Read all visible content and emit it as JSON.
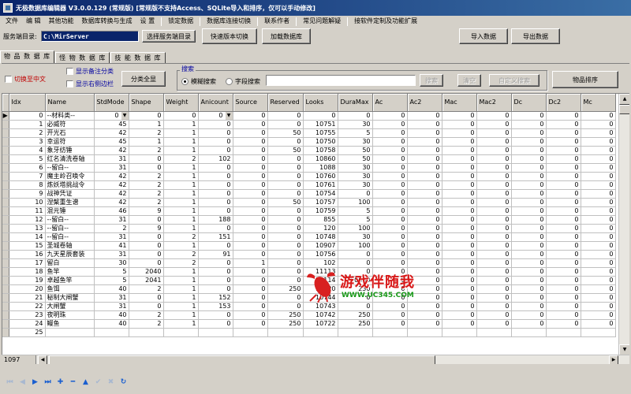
{
  "window": {
    "title": "无极数据库编辑器 V3.0.0.129 (常规版) [常规版不支持Access、SQLite导入和排序，仅可以手动修改]"
  },
  "menu": {
    "items": [
      "文件",
      "编 辑",
      "其他功能",
      "数据库转换与生成",
      "设 置"
    ],
    "items2": [
      "锁定数据",
      "数据库连接切换",
      "联系作者",
      "常见问题解疑",
      "接软件定制及功能扩展"
    ]
  },
  "toolbar": {
    "server_dir_label": "服务端目录:",
    "server_dir_value": "C:\\MirServer",
    "select_dir_button": "选择服务端目录",
    "quick_switch_button": "快速版本切换",
    "load_db_button": "加载数据库",
    "import_button": "导入数据",
    "export_button": "导出数据"
  },
  "tabs": [
    "物 品 数 据 库",
    "怪 物 数 据 库",
    "技 能 数 据 库"
  ],
  "options": {
    "switch_chinese": "切换至中文",
    "show_notes_category": "显示备注分类",
    "show_right_sidebar": "显示右侧边栏",
    "category_all_button": "分类全显",
    "search_group_title": "搜索",
    "fuzzy_search": "模糊搜索",
    "field_search": "字段搜索",
    "search_button": "搜索",
    "clear_button": "清空",
    "custom_search_button": "自定义搜索",
    "item_sort_button": "物品排序"
  },
  "grid": {
    "columns": [
      "Idx",
      "Name",
      "StdMode",
      "Shape",
      "Weight",
      "Anicount",
      "Source",
      "Reserved",
      "Looks",
      "DuraMax",
      "Ac",
      "Ac2",
      "Mac",
      "Mac2",
      "Dc",
      "Dc2",
      "Mc"
    ],
    "rows": [
      [
        "0",
        "--材料类--",
        "0",
        "0",
        "0",
        "0",
        "0",
        "0",
        "0",
        "0",
        "0",
        "0",
        "0",
        "0",
        "0",
        "0",
        "0"
      ],
      [
        "1",
        "必威符",
        "45",
        "1",
        "1",
        "0",
        "0",
        "0",
        "10751",
        "30",
        "0",
        "0",
        "0",
        "0",
        "0",
        "0",
        "0"
      ],
      [
        "2",
        "开光石",
        "42",
        "2",
        "1",
        "0",
        "0",
        "50",
        "10755",
        "5",
        "0",
        "0",
        "0",
        "0",
        "0",
        "0",
        "0"
      ],
      [
        "3",
        "幸运符",
        "45",
        "1",
        "1",
        "0",
        "0",
        "0",
        "10750",
        "30",
        "0",
        "0",
        "0",
        "0",
        "0",
        "0",
        "0"
      ],
      [
        "4",
        "象牙纺锤",
        "42",
        "2",
        "1",
        "0",
        "0",
        "50",
        "10758",
        "50",
        "0",
        "0",
        "0",
        "0",
        "0",
        "0",
        "0"
      ],
      [
        "5",
        "红名清洗卷轴",
        "31",
        "0",
        "2",
        "102",
        "0",
        "0",
        "10860",
        "50",
        "0",
        "0",
        "0",
        "0",
        "0",
        "0",
        "0"
      ],
      [
        "6",
        "--留白--",
        "31",
        "0",
        "1",
        "0",
        "0",
        "0",
        "1088",
        "30",
        "0",
        "0",
        "0",
        "0",
        "0",
        "0",
        "0"
      ],
      [
        "7",
        "魔主岭召唤令",
        "42",
        "2",
        "1",
        "0",
        "0",
        "0",
        "10760",
        "30",
        "0",
        "0",
        "0",
        "0",
        "0",
        "0",
        "0"
      ],
      [
        "8",
        "炼妖塔挑战令",
        "42",
        "2",
        "1",
        "0",
        "0",
        "0",
        "10761",
        "30",
        "0",
        "0",
        "0",
        "0",
        "0",
        "0",
        "0"
      ],
      [
        "9",
        "战神凭证",
        "42",
        "2",
        "1",
        "0",
        "0",
        "0",
        "10754",
        "0",
        "0",
        "0",
        "0",
        "0",
        "0",
        "0",
        "0"
      ],
      [
        "10",
        "涅槃重生谱",
        "42",
        "2",
        "1",
        "0",
        "0",
        "50",
        "10757",
        "100",
        "0",
        "0",
        "0",
        "0",
        "0",
        "0",
        "0"
      ],
      [
        "11",
        "混元锤",
        "46",
        "9",
        "1",
        "0",
        "0",
        "0",
        "10759",
        "5",
        "0",
        "0",
        "0",
        "0",
        "0",
        "0",
        "0"
      ],
      [
        "12",
        "--留白--",
        "31",
        "0",
        "1",
        "188",
        "0",
        "0",
        "855",
        "5",
        "0",
        "0",
        "0",
        "0",
        "0",
        "0",
        "0"
      ],
      [
        "13",
        "--留白--",
        "2",
        "9",
        "1",
        "0",
        "0",
        "0",
        "120",
        "100",
        "0",
        "0",
        "0",
        "0",
        "0",
        "0",
        "0"
      ],
      [
        "14",
        "--留白--",
        "31",
        "0",
        "2",
        "151",
        "0",
        "0",
        "10748",
        "30",
        "0",
        "0",
        "0",
        "0",
        "0",
        "0",
        "0"
      ],
      [
        "15",
        "圣城卷轴",
        "41",
        "0",
        "1",
        "0",
        "0",
        "0",
        "10907",
        "100",
        "0",
        "0",
        "0",
        "0",
        "0",
        "0",
        "0"
      ],
      [
        "16",
        "九天星辰套装",
        "31",
        "0",
        "2",
        "91",
        "0",
        "0",
        "10756",
        "0",
        "0",
        "0",
        "0",
        "0",
        "0",
        "0",
        "0"
      ],
      [
        "17",
        "留白",
        "30",
        "0",
        "2",
        "0",
        "1",
        "0",
        "102",
        "0",
        "0",
        "0",
        "0",
        "0",
        "0",
        "0",
        "0"
      ],
      [
        "18",
        "鱼竿",
        "5",
        "2040",
        "1",
        "0",
        "0",
        "0",
        "11113",
        "0",
        "0",
        "0",
        "0",
        "0",
        "0",
        "0",
        "0"
      ],
      [
        "19",
        "卓越鱼竿",
        "5",
        "2041",
        "1",
        "0",
        "0",
        "0",
        "11114",
        "60000",
        "0",
        "0",
        "0",
        "0",
        "0",
        "0",
        "0"
      ],
      [
        "20",
        "鱼饵",
        "40",
        "2",
        "1",
        "0",
        "0",
        "250",
        "10720",
        "250",
        "0",
        "0",
        "0",
        "0",
        "0",
        "0",
        "0"
      ],
      [
        "21",
        "秘制大闸蟹",
        "31",
        "0",
        "1",
        "152",
        "0",
        "0",
        "10744",
        "0",
        "0",
        "0",
        "0",
        "0",
        "0",
        "0",
        "0"
      ],
      [
        "22",
        "大闸蟹",
        "31",
        "0",
        "1",
        "153",
        "0",
        "0",
        "10743",
        "0",
        "0",
        "0",
        "0",
        "0",
        "0",
        "0",
        "0"
      ],
      [
        "23",
        "夜明珠",
        "40",
        "2",
        "1",
        "0",
        "0",
        "250",
        "10742",
        "250",
        "0",
        "0",
        "0",
        "0",
        "0",
        "0",
        "0"
      ],
      [
        "24",
        "鳗鱼",
        "40",
        "2",
        "1",
        "0",
        "0",
        "250",
        "10722",
        "250",
        "0",
        "0",
        "0",
        "0",
        "0",
        "0",
        "0"
      ],
      [
        "25",
        "",
        "",
        "",
        "",
        "",
        "",
        "",
        "",
        "",
        "",
        "",
        "",
        "",
        "",
        "",
        ""
      ]
    ]
  },
  "status": {
    "record_count": "1097"
  },
  "watermark": {
    "text": "游戏伴随我",
    "url": "WWW.UC345.COM"
  },
  "colors": {
    "title_bar": "#0a246a",
    "face": "#d4d0c8",
    "switch_text": "#c00000",
    "search_group_title": "#0000a0",
    "nav_icon": "#1a5fd0"
  }
}
